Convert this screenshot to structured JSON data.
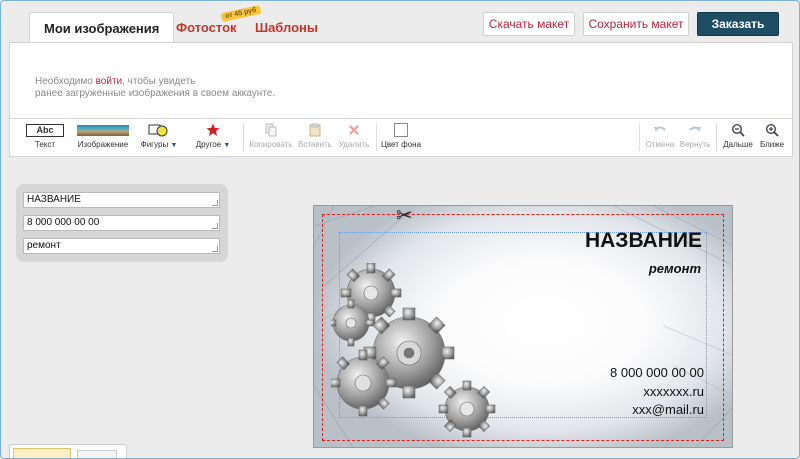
{
  "tabs": {
    "my_images": "Мои изображения",
    "photostock": "Фотосток",
    "photostock_badge": "от 45 руб",
    "templates": "Шаблоны"
  },
  "actions": {
    "download": "Скачать макет",
    "save": "Сохранить макет",
    "order": "Заказать"
  },
  "images_panel": {
    "msg_prefix": "Необходимо ",
    "login_link": "войти",
    "msg_suffix": ", чтобы увидеть",
    "msg_line2": "ранее загруженные изображения в своем аккаунте."
  },
  "toolbar": {
    "text_icon": "Abc",
    "text": "Текст",
    "image": "Изображение",
    "shapes": "Фигуры",
    "other": "Другое",
    "copy": "Копировать",
    "paste": "Вставить",
    "delete": "Удалить",
    "bg_color": "Цвет фона",
    "undo": "Отмена",
    "redo": "Вернуть",
    "zoom_out": "Дальше",
    "zoom_in": "Ближе"
  },
  "fields": {
    "name": "НАЗВАНИЕ",
    "phone": "8 000 000 00 00",
    "service": "ремонт"
  },
  "card": {
    "name": "НАЗВАНИЕ",
    "service": "ремонт",
    "phone": "8 000 000 00 00",
    "website": "xxxxxxx.ru",
    "email": "xxx@mail.ru"
  },
  "colors": {
    "accent": "#b8243c",
    "order_button": "#1d4e63",
    "cut_line": "#e02020",
    "safe_line": "#6c9bd6"
  }
}
